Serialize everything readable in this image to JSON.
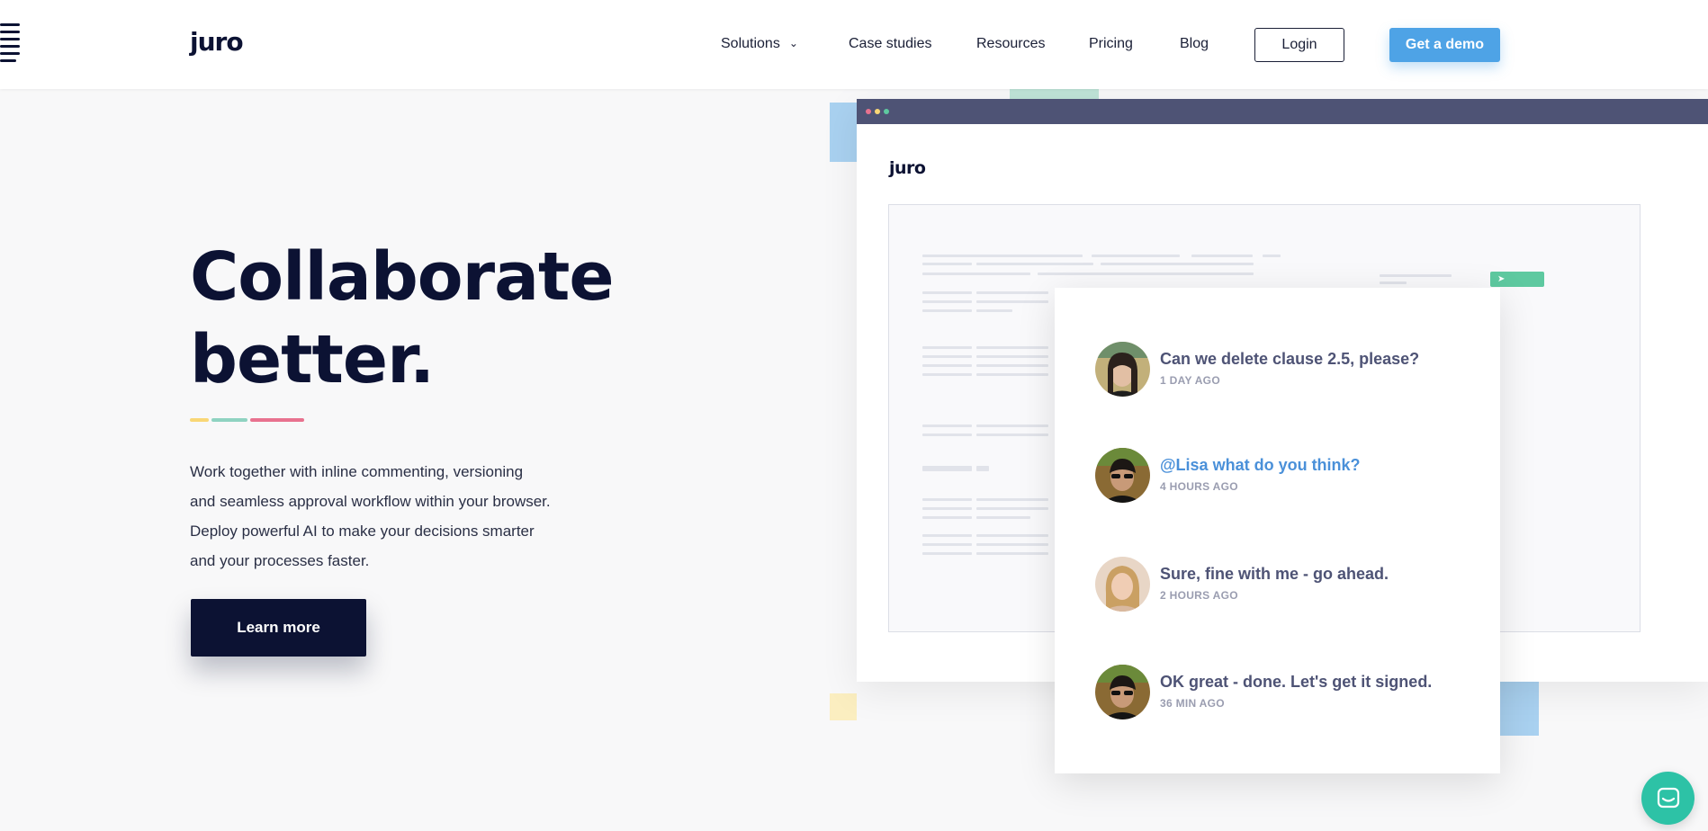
{
  "header": {
    "logo": "juro",
    "nav": [
      {
        "label": "Solutions",
        "has_dropdown": true
      },
      {
        "label": "Case studies"
      },
      {
        "label": "Resources"
      },
      {
        "label": "Pricing"
      },
      {
        "label": "Blog"
      }
    ],
    "login_label": "Login",
    "demo_label": "Get a demo"
  },
  "hero": {
    "title_line1": "Collaborate",
    "title_line2": "better.",
    "body_lines": [
      "Work together with inline commenting, versioning",
      "and seamless approval workflow within your browser.",
      "Deploy powerful AI to make your decisions smarter",
      "and your processes faster."
    ],
    "cta_label": "Learn more"
  },
  "app_mock": {
    "logo": "juro",
    "comments": [
      {
        "text": "Can we delete clause 2.5, please?",
        "time": "1 DAY AGO",
        "mention": false
      },
      {
        "text": "@Lisa what do you think?",
        "time": "4 HOURS AGO",
        "mention": true
      },
      {
        "text": "Sure, fine with me - go ahead.",
        "time": "2 HOURS AGO",
        "mention": false
      },
      {
        "text": "OK great - done. Let's get it signed.",
        "time": "36 MIN AGO",
        "mention": false
      }
    ]
  },
  "colors": {
    "brand_dark": "#0c1233",
    "accent_blue": "#4ea3e6",
    "mention_blue": "#4a90d9",
    "accent_yellow": "#f9d776",
    "accent_teal": "#8fd3c1",
    "accent_pink": "#e8728f",
    "chat_teal": "#2dc2a6"
  }
}
